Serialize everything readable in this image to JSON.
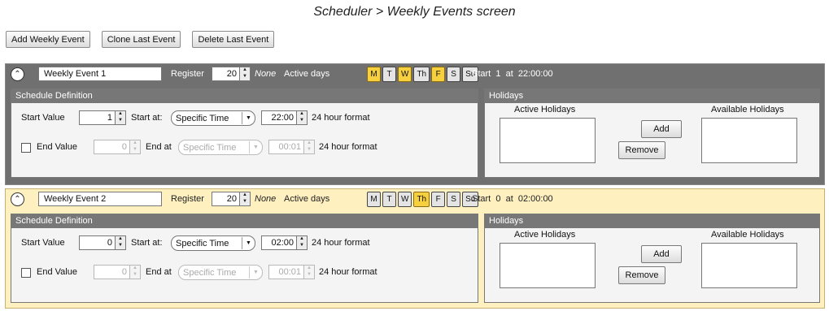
{
  "caption": "Scheduler > Weekly Events screen",
  "toolbar": {
    "add_label": "Add Weekly Event",
    "clone_label": "Clone Last Event",
    "delete_label": "Delete Last Event"
  },
  "colors": {
    "event1_header_bg": "#707070",
    "event2_header_bg": "#fff0c0",
    "active_day": "#f7d040",
    "inactive_day": "#e4e4e4",
    "panel_title_bg": "#777777"
  },
  "events": [
    {
      "name": "Weekly Event 1",
      "register_label": "Register",
      "register_value": "20",
      "none_label": "None",
      "active_days_label": "Active days",
      "days": [
        {
          "label": "M",
          "active": true
        },
        {
          "label": "T",
          "active": false
        },
        {
          "label": "W",
          "active": true
        },
        {
          "label": "Th",
          "active": false
        },
        {
          "label": "F",
          "active": true
        },
        {
          "label": "S",
          "active": false
        },
        {
          "label": "Su",
          "active": false
        }
      ],
      "summary": "Start  1  at  22:00:00",
      "schedule": {
        "title": "Schedule Definition",
        "start_value_label": "Start Value",
        "start_value": "1",
        "start_at_label": "Start at:",
        "start_at_option": "Specific Time",
        "start_time": "22:00",
        "format_label": "24 hour format",
        "end_value_label": "End Value",
        "end_value": "0",
        "end_at_label": "End at",
        "end_at_option": "Specific Time",
        "end_time": "00:01",
        "end_format_label": "24 hour format",
        "end_enabled": false
      },
      "holidays": {
        "title": "Holidays",
        "active_label": "Active Holidays",
        "available_label": "Available Holidays",
        "add_label": "Add",
        "remove_label": "Remove"
      }
    },
    {
      "name": "Weekly Event 2",
      "register_label": "Register",
      "register_value": "20",
      "none_label": "None",
      "active_days_label": "Active days",
      "days": [
        {
          "label": "M",
          "active": false
        },
        {
          "label": "T",
          "active": false
        },
        {
          "label": "W",
          "active": false
        },
        {
          "label": "Th",
          "active": true
        },
        {
          "label": "F",
          "active": false
        },
        {
          "label": "S",
          "active": false
        },
        {
          "label": "Su",
          "active": false
        }
      ],
      "summary": "Start  0  at  02:00:00",
      "schedule": {
        "title": "Schedule Definition",
        "start_value_label": "Start Value",
        "start_value": "0",
        "start_at_label": "Start at:",
        "start_at_option": "Specific Time",
        "start_time": "02:00",
        "format_label": "24 hour format",
        "end_value_label": "End Value",
        "end_value": "0",
        "end_at_label": "End at",
        "end_at_option": "Specific Time",
        "end_time": "00:01",
        "end_format_label": "24 hour format",
        "end_enabled": false
      },
      "holidays": {
        "title": "Holidays",
        "active_label": "Active Holidays",
        "available_label": "Available Holidays",
        "add_label": "Add",
        "remove_label": "Remove"
      }
    }
  ]
}
